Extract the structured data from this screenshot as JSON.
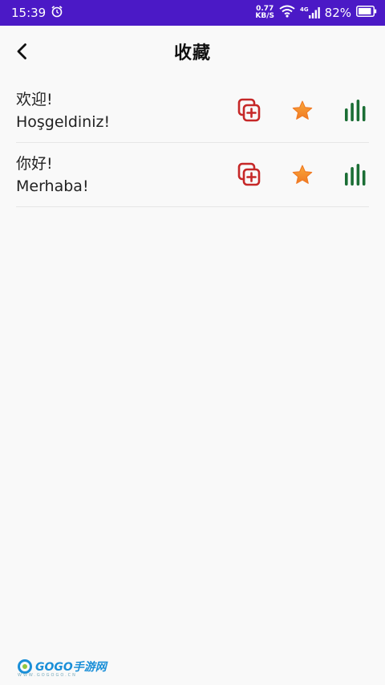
{
  "status_bar": {
    "time": "15:39",
    "net_speed_value": "0.77",
    "net_speed_unit": "KB/S",
    "network_type": "4G",
    "battery": "82%"
  },
  "header": {
    "title": "收藏"
  },
  "favorites": [
    {
      "source": "欢迎!",
      "target": "Hoşgeldiniz!"
    },
    {
      "source": "你好!",
      "target": "Merhaba!"
    }
  ],
  "watermark": {
    "text": "GOGO手游网",
    "sub": "WWW.GOGOGO.CN"
  },
  "colors": {
    "status_bar": "#4b19c6",
    "copy_icon": "#c62828",
    "star_icon": "#f5892a",
    "chart_icon": "#1b6e35"
  },
  "icons": {
    "back": "chevron-left-icon",
    "copy": "copy-add-icon",
    "favorite": "star-icon",
    "stats": "bar-chart-icon"
  }
}
